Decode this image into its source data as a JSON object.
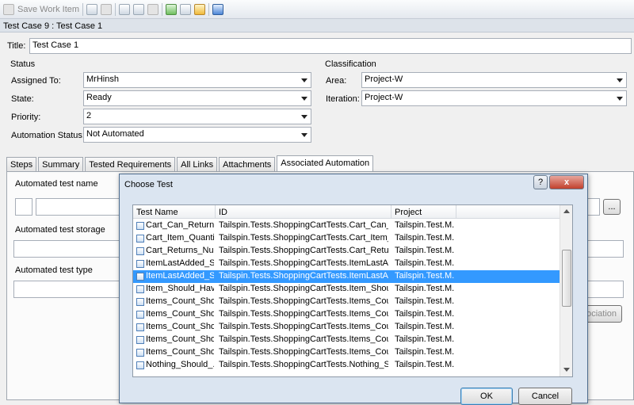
{
  "toolbar": {
    "save_label": "Save Work Item"
  },
  "work_item": {
    "header": "Test Case 9 : Test Case 1",
    "title_label": "Title:",
    "title_value": "Test Case 1"
  },
  "status": {
    "heading": "Status",
    "assigned_to": {
      "label": "Assigned To:",
      "value": "MrHinsh"
    },
    "state": {
      "label": "State:",
      "value": "Ready"
    },
    "priority": {
      "label": "Priority:",
      "value": "2"
    },
    "automation_status": {
      "label": "Automation Status:",
      "value": "Not Automated"
    }
  },
  "classification": {
    "heading": "Classification",
    "area": {
      "label": "Area:",
      "value": "Project-W"
    },
    "iteration": {
      "label": "Iteration:",
      "value": "Project-W"
    }
  },
  "tabs": [
    "Steps",
    "Summary",
    "Tested Requirements",
    "All Links",
    "Attachments",
    "Associated Automation"
  ],
  "automation_panel": {
    "test_name_label": "Automated test name",
    "test_storage_label": "Automated test storage",
    "test_type_label": "Automated test type",
    "browse_label": "...",
    "remove_association_label": "ociation"
  },
  "dialog": {
    "title": "Choose Test",
    "help_label": "?",
    "close_label": "x",
    "columns": [
      "Test Name",
      "ID",
      "Project"
    ],
    "rows": [
      [
        "Cart_Can_Return_...",
        "Tailspin.Tests.ShoppingCartTests.Cart_Can_Ret...",
        "Tailspin.Test.M..."
      ],
      [
        "Cart_Item_Quanti...",
        "Tailspin.Tests.ShoppingCartTests.Cart_Item_Qu...",
        "Tailspin.Test.M..."
      ],
      [
        "Cart_Returns_Null...",
        "Tailspin.Tests.ShoppingCartTests.Cart_Returns_...",
        "Tailspin.Test.M..."
      ],
      [
        "ItemLastAdded_S...",
        "Tailspin.Tests.ShoppingCartTests.ItemLastAdd...",
        "Tailspin.Test.M..."
      ],
      [
        "ItemLastAdded_S...",
        "Tailspin.Tests.ShoppingCartTests.ItemLastAdd...",
        "Tailspin.Test.M..."
      ],
      [
        "Item_Should_Hav...",
        "Tailspin.Tests.ShoppingCartTests.Item_Should_...",
        "Tailspin.Test.M..."
      ],
      [
        "Items_Count_Sho...",
        "Tailspin.Tests.ShoppingCartTests.Items_Count_...",
        "Tailspin.Test.M..."
      ],
      [
        "Items_Count_Sho...",
        "Tailspin.Tests.ShoppingCartTests.Items_Count_...",
        "Tailspin.Test.M..."
      ],
      [
        "Items_Count_Sho...",
        "Tailspin.Tests.ShoppingCartTests.Items_Count_...",
        "Tailspin.Test.M..."
      ],
      [
        "Items_Count_Sho...",
        "Tailspin.Tests.ShoppingCartTests.Items_Count_...",
        "Tailspin.Test.M..."
      ],
      [
        "Items_Count_Sho...",
        "Tailspin.Tests.ShoppingCartTests.Items_Count_...",
        "Tailspin.Test.M..."
      ],
      [
        "Nothing_Should_...",
        "Tailspin.Tests.ShoppingCartTests.Nothing_Sho...",
        "Tailspin.Test.M..."
      ]
    ],
    "selected_row": 4,
    "ok_label": "OK",
    "cancel_label": "Cancel"
  },
  "colors": {
    "selection": "#3399ff",
    "dialog_frame": "#dbe5f1",
    "close_button": "#c1402c"
  }
}
